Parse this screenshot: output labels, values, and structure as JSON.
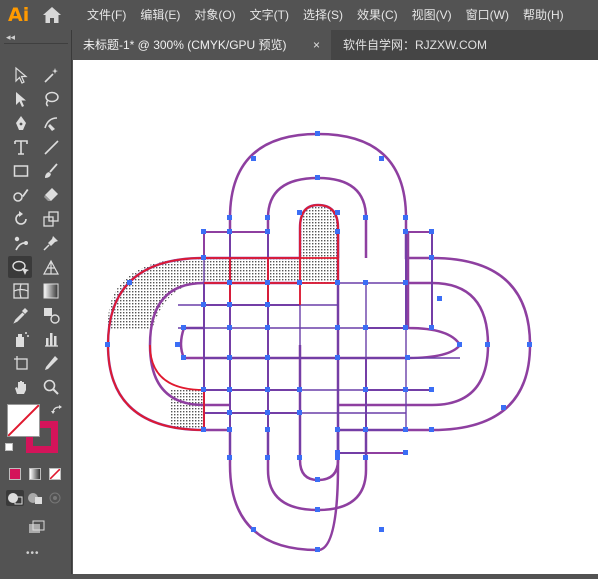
{
  "app": {
    "logo": "Ai"
  },
  "menu": [
    "文件(F)",
    "编辑(E)",
    "对象(O)",
    "文字(T)",
    "选择(S)",
    "效果(C)",
    "视图(V)",
    "窗口(W)",
    "帮助(H)"
  ],
  "tabs": {
    "active": "未标题-1* @ 300% (CMYK/GPU 预览)",
    "close": "×",
    "second": "软件自学网：RJZXW.COM"
  },
  "toolbox": {
    "collapse": "◂◂",
    "more": "•••"
  },
  "colors": {
    "stroke_swatch": "#d4145a",
    "path_stroke": "#8e3fa0",
    "selection": "#3b6ef5",
    "highlight": "#e0192f"
  }
}
